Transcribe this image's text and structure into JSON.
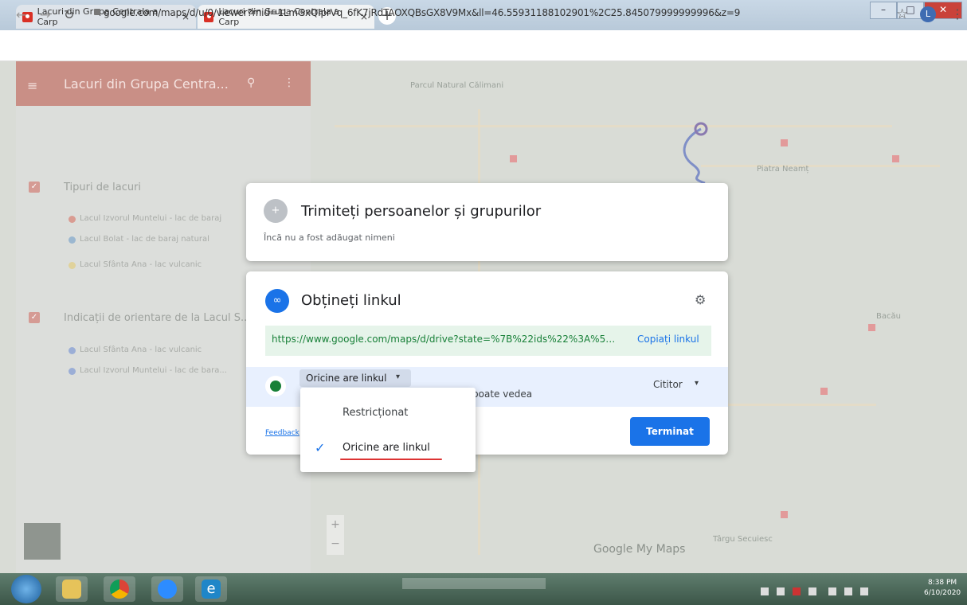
{
  "browser": {
    "tabs": [
      {
        "title": "Lacuri din Grupa Centrala a Carp"
      },
      {
        "title": "Lacuri din Grupa Centrala a Carp"
      }
    ],
    "url": "google.com/maps/d/u/0/viewer?mid=1LmGxQIprVq_6fK7jRdTAOXQBsGX8V9Mx&ll=46.55931188102901%2C25.845079999999996&z=9",
    "profile_initial": "L"
  },
  "sidebar": {
    "title": "Lacuri din Grupa Centra...",
    "layers": [
      {
        "name": "Tipuri de lacuri",
        "items": [
          "Lacul Izvorul Muntelui - lac de baraj",
          "Lacul Bolat - lac de baraj natural",
          "Lacul Sfânta Ana - lac vulcanic"
        ]
      },
      {
        "name": "Indicații de orientare de la Lacul S...",
        "items": [
          "Lacul Sfânta Ana - lac vulcanic",
          "Lacul Izvorul Muntelui - lac de bara..."
        ]
      }
    ]
  },
  "share_dialog": {
    "title": "Trimiteți persoanelor și grupurilor",
    "subtitle": "Încă nu a fost adăugat nimeni"
  },
  "link_dialog": {
    "title": "Obțineți linkul",
    "url": "https://www.google.com/maps/d/drive?state=%7B%22ids%22%3A%5B...",
    "copy_label": "Copiați linkul",
    "access_label": "Oricine are linkul",
    "access_desc": "poate vedea",
    "role": "Cititor",
    "done_label": "Terminat",
    "feedback": "Feedback"
  },
  "access_dropdown": {
    "options": [
      "Restricționat",
      "Oricine are linkul"
    ],
    "selected": "Oricine are linkul"
  },
  "map": {
    "labels": [
      "Parcul Natural Călimani",
      "Piatra Neamț",
      "Bacău",
      "Târgu Secuiesc",
      "Google My Maps"
    ]
  },
  "taskbar": {
    "time": "8:38 PM",
    "date": "6/10/2020"
  }
}
